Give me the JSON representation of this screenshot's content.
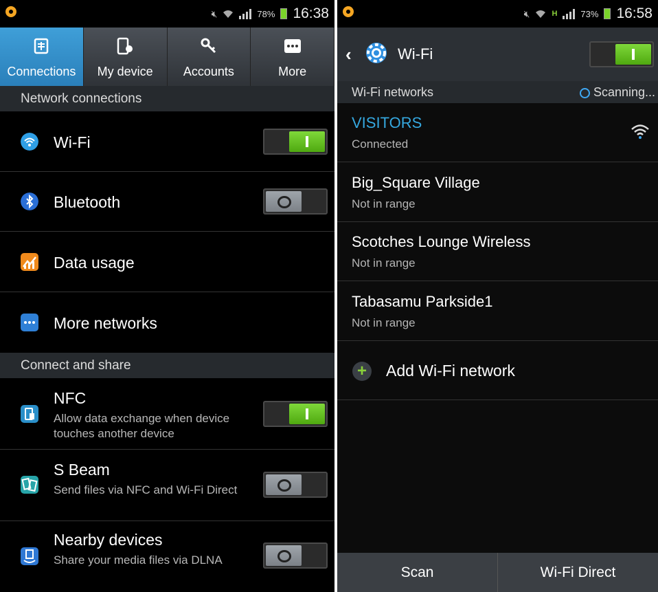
{
  "left": {
    "status": {
      "battery": "78%",
      "time": "16:38"
    },
    "tabs": [
      {
        "label": "Connections",
        "icon": "connections-icon",
        "active": true
      },
      {
        "label": "My device",
        "icon": "device-icon",
        "active": false
      },
      {
        "label": "Accounts",
        "icon": "key-icon",
        "active": false
      },
      {
        "label": "More",
        "icon": "more-icon",
        "active": false
      }
    ],
    "sections": {
      "network": "Network connections",
      "share": "Connect and share"
    },
    "network_items": [
      {
        "label": "Wi-Fi",
        "toggle": "on"
      },
      {
        "label": "Bluetooth",
        "toggle": "off"
      },
      {
        "label": "Data usage"
      },
      {
        "label": "More networks"
      }
    ],
    "share_items": [
      {
        "label": "NFC",
        "sub": "Allow data exchange when device touches another device",
        "toggle": "on"
      },
      {
        "label": "S Beam",
        "sub": "Send files via NFC and Wi-Fi Direct",
        "toggle": "off"
      },
      {
        "label": "Nearby devices",
        "sub": "Share your media files via DLNA",
        "toggle": "off"
      }
    ]
  },
  "right": {
    "status": {
      "battery": "73%",
      "time": "16:58"
    },
    "title": "Wi-Fi",
    "wifi_enabled": true,
    "networks_header": "Wi-Fi networks",
    "scanning": "Scanning...",
    "networks": [
      {
        "name": "VISITORS",
        "status": "Connected",
        "connected": true
      },
      {
        "name": "Big_Square Village",
        "status": "Not in range"
      },
      {
        "name": "Scotches Lounge Wireless",
        "status": "Not in range"
      },
      {
        "name": "Tabasamu Parkside1",
        "status": "Not in range"
      }
    ],
    "add_network": "Add Wi-Fi network",
    "buttons": {
      "scan": "Scan",
      "wifi_direct": "Wi-Fi Direct"
    }
  },
  "colors": {
    "accent": "#3fa9f5",
    "toggle_on": "#6cc72a",
    "connected_name": "#35a8e0"
  }
}
